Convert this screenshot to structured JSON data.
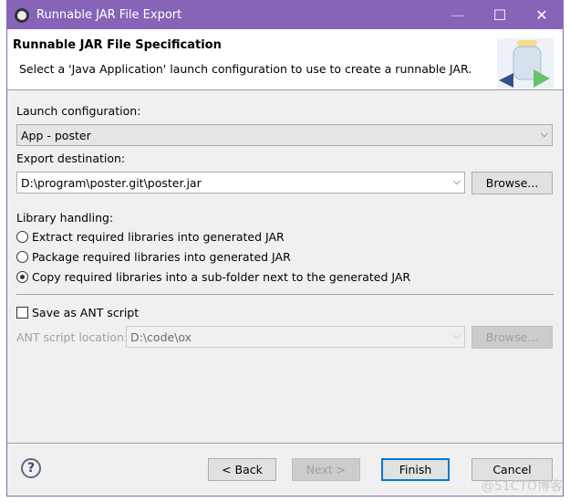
{
  "window": {
    "title": "Runnable JAR File Export",
    "accent": "#8764b8"
  },
  "header": {
    "title": "Runnable JAR File Specification",
    "description": "Select a 'Java Application' launch configuration to use to create a runnable JAR."
  },
  "launch": {
    "label": "Launch configuration:",
    "value": "App - poster"
  },
  "export": {
    "label": "Export destination:",
    "value": "D:\\program\\poster.git\\poster.jar",
    "browse": "Browse..."
  },
  "library": {
    "label": "Library handling:",
    "options": [
      {
        "label": "Extract required libraries into generated JAR",
        "selected": false
      },
      {
        "label": "Package required libraries into generated JAR",
        "selected": false
      },
      {
        "label": "Copy required libraries into a sub-folder next to the generated JAR",
        "selected": true
      }
    ]
  },
  "ant": {
    "checkbox": "Save as ANT script",
    "checked": false,
    "location_label": "ANT script location:",
    "location_value": "D:\\code\\ox",
    "browse": "Browse..."
  },
  "buttons": {
    "back": "< Back",
    "next": "Next >",
    "finish": "Finish",
    "cancel": "Cancel",
    "help": "?"
  },
  "watermark": "@51CTO博客"
}
